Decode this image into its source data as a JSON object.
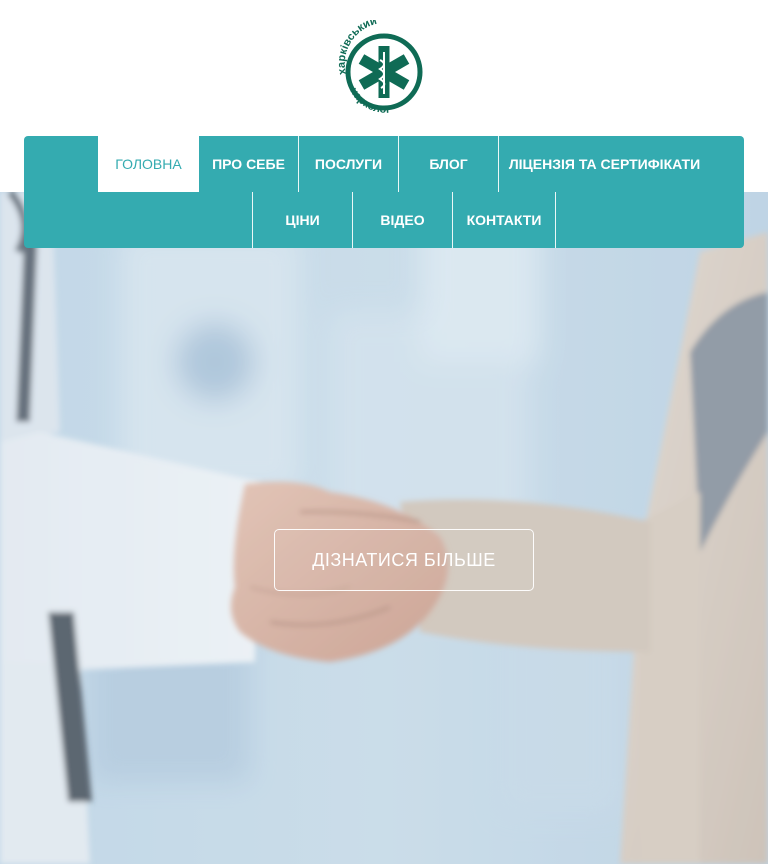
{
  "logo": {
    "text_top": "харківський",
    "text_bottom": "нарколог",
    "icon": "star-of-life-icon"
  },
  "nav": {
    "items_row1": [
      {
        "label": "ГОЛОВНА",
        "active": true
      },
      {
        "label": "ПРО СЕБЕ",
        "active": false
      },
      {
        "label": "ПОСЛУГИ",
        "active": false
      },
      {
        "label": "БЛОГ",
        "active": false
      },
      {
        "label": "ЛІЦЕНЗІЯ ТА СЕРТИФІКАТИ",
        "active": false
      }
    ],
    "items_row2": [
      {
        "label": "ЦІНИ",
        "active": false
      },
      {
        "label": "ВІДЕО",
        "active": false
      },
      {
        "label": "КОНТАКТИ",
        "active": false
      }
    ]
  },
  "hero": {
    "image": "handshake-doctor-patient",
    "cta_label": "ДІЗНАТИСЯ БІЛЬШЕ"
  },
  "colors": {
    "accent": "#34abb0",
    "logo_green": "#0f6b55",
    "white": "#ffffff"
  }
}
